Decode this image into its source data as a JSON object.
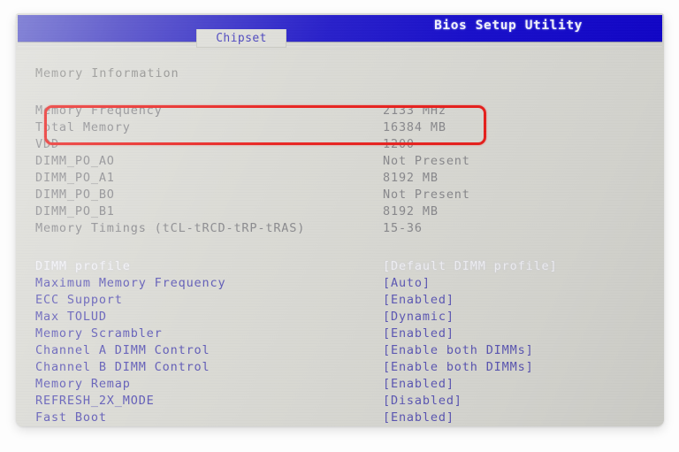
{
  "window": {
    "title": "Bios Setup Utility",
    "active_tab": "Chipset",
    "tabs": [
      "Chipset"
    ]
  },
  "colors": {
    "title_bar_blue": "#1208cb",
    "setting_text": "#5a55b4",
    "info_text": "#86868a",
    "selected_text": "#f2f2f6",
    "annotation_red": "#e81b18",
    "screen_background": "#d9d9d3"
  },
  "main": {
    "section_heading": "Memory Information",
    "info_rows": [
      {
        "label": "Memory Frequency",
        "value": "2133 MHz",
        "annotated": true
      },
      {
        "label": "Total Memory",
        "value": "16384 MB",
        "annotated": true
      },
      {
        "label": "VDD",
        "value": "1200",
        "annotated": false
      },
      {
        "label": "DIMM_PO_AO",
        "value": "Not Present",
        "annotated": false
      },
      {
        "label": "DIMM_PO_A1",
        "value": "8192 MB",
        "annotated": false
      },
      {
        "label": "DIMM_PO_BO",
        "value": "Not Present",
        "annotated": false
      },
      {
        "label": "DIMM_PO_B1",
        "value": "8192 MB",
        "annotated": false
      },
      {
        "label": "Memory Timings (tCL-tRCD-tRP-tRAS)",
        "value": "15-36",
        "annotated": false
      }
    ],
    "setting_rows": [
      {
        "label": "DIMM profile",
        "value": "[Default DIMM profile]",
        "selected": true
      },
      {
        "label": "Maximum Memory Frequency",
        "value": "[Auto]",
        "selected": false
      },
      {
        "label": "ECC Support",
        "value": "[Enabled]",
        "selected": false
      },
      {
        "label": "Max TOLUD",
        "value": "[Dynamic]",
        "selected": false
      },
      {
        "label": "Memory Scrambler",
        "value": "[Enabled]",
        "selected": false
      },
      {
        "label": "Channel A DIMM Control",
        "value": "[Enable both DIMMs]",
        "selected": false
      },
      {
        "label": "Channel B DIMM Control",
        "value": "[Enable both DIMMs]",
        "selected": false
      },
      {
        "label": "Memory Remap",
        "value": "[Enabled]",
        "selected": false
      },
      {
        "label": "REFRESH_2X_MODE",
        "value": "[Disabled]",
        "selected": false
      },
      {
        "label": "Fast Boot",
        "value": "[Enabled]",
        "selected": false
      }
    ]
  },
  "annotation": {
    "type": "red-rectangle-highlight",
    "covers": [
      "Memory Frequency",
      "Total Memory"
    ]
  }
}
